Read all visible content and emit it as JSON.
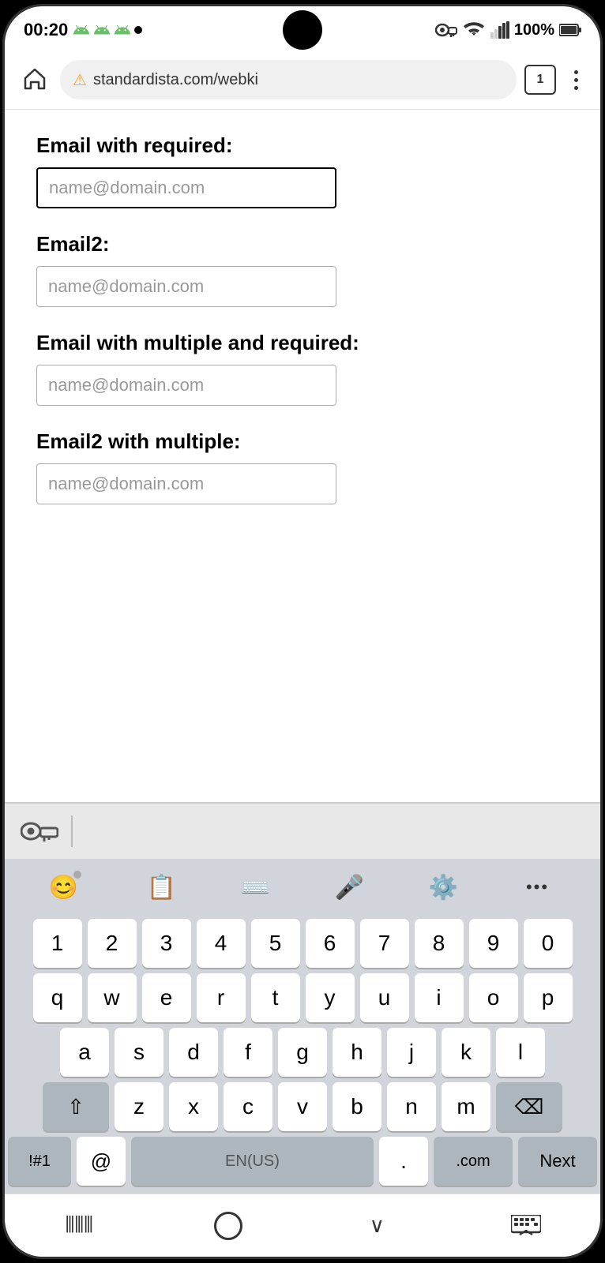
{
  "status_bar": {
    "time": "00:20",
    "battery": "100%",
    "tab_count": "1"
  },
  "browser": {
    "url": "standardista.com/webki"
  },
  "form": {
    "field1": {
      "label": "Email with required:",
      "placeholder": "name@domain.com",
      "active": true
    },
    "field2": {
      "label": "Email2:",
      "placeholder": "name@domain.com"
    },
    "field3": {
      "label": "Email with multiple and required:",
      "placeholder": "name@domain.com"
    },
    "field4": {
      "label": "Email2 with multiple:",
      "placeholder": "name@domain.com"
    }
  },
  "keyboard": {
    "toolbar": {
      "emoji_label": "😊",
      "clipboard_label": "⊟",
      "keyboard_label": "⌨",
      "mic_label": "🎤",
      "settings_label": "⚙",
      "more_label": "···"
    },
    "rows": {
      "numbers": [
        "1",
        "2",
        "3",
        "4",
        "5",
        "6",
        "7",
        "8",
        "9",
        "0"
      ],
      "row1": [
        "q",
        "w",
        "e",
        "r",
        "t",
        "y",
        "u",
        "i",
        "o",
        "p"
      ],
      "row2": [
        "a",
        "s",
        "d",
        "f",
        "g",
        "h",
        "j",
        "k",
        "l"
      ],
      "row3": [
        "z",
        "x",
        "c",
        "v",
        "b",
        "n",
        "m"
      ],
      "bottom": {
        "symbols": "!#1",
        "at": "@",
        "space": "EN(US)",
        "period": ".",
        "dotcom": ".com",
        "next": "Next"
      }
    }
  },
  "bottom_nav": {
    "back": "◀",
    "home": "○",
    "down": "∨",
    "keyboard_hide": "⌨"
  }
}
